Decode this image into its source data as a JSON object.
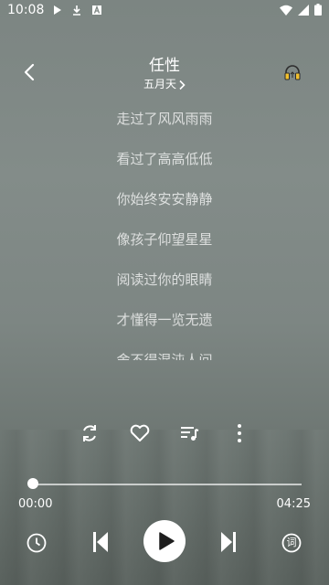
{
  "status_bar": {
    "time": "10:08",
    "left_icons": [
      "play-icon",
      "download-icon",
      "a-box-icon"
    ],
    "right_icons": [
      "wifi-icon",
      "signal-icon",
      "battery-icon"
    ]
  },
  "header": {
    "title": "任性",
    "artist": "五月天"
  },
  "lyrics": [
    "走过了风风雨雨",
    "看过了高高低低",
    "你始终安安静静",
    "像孩子仰望星星",
    "阅读过你的眼睛",
    "才懂得一览无遗",
    "舍不得混沌人间"
  ],
  "actions": [
    "repeat-icon",
    "heart-icon",
    "playlist-icon",
    "more-vertical-icon"
  ],
  "progress": {
    "current": "00:00",
    "total": "04:25",
    "fraction": 0.0
  },
  "controls": [
    "history-icon",
    "previous-icon",
    "play-icon",
    "next-icon",
    "lyrics-icon"
  ],
  "lyrics_button_glyph": "词",
  "colors": {
    "foreground": "#ffffff",
    "background": "#7f8885"
  }
}
